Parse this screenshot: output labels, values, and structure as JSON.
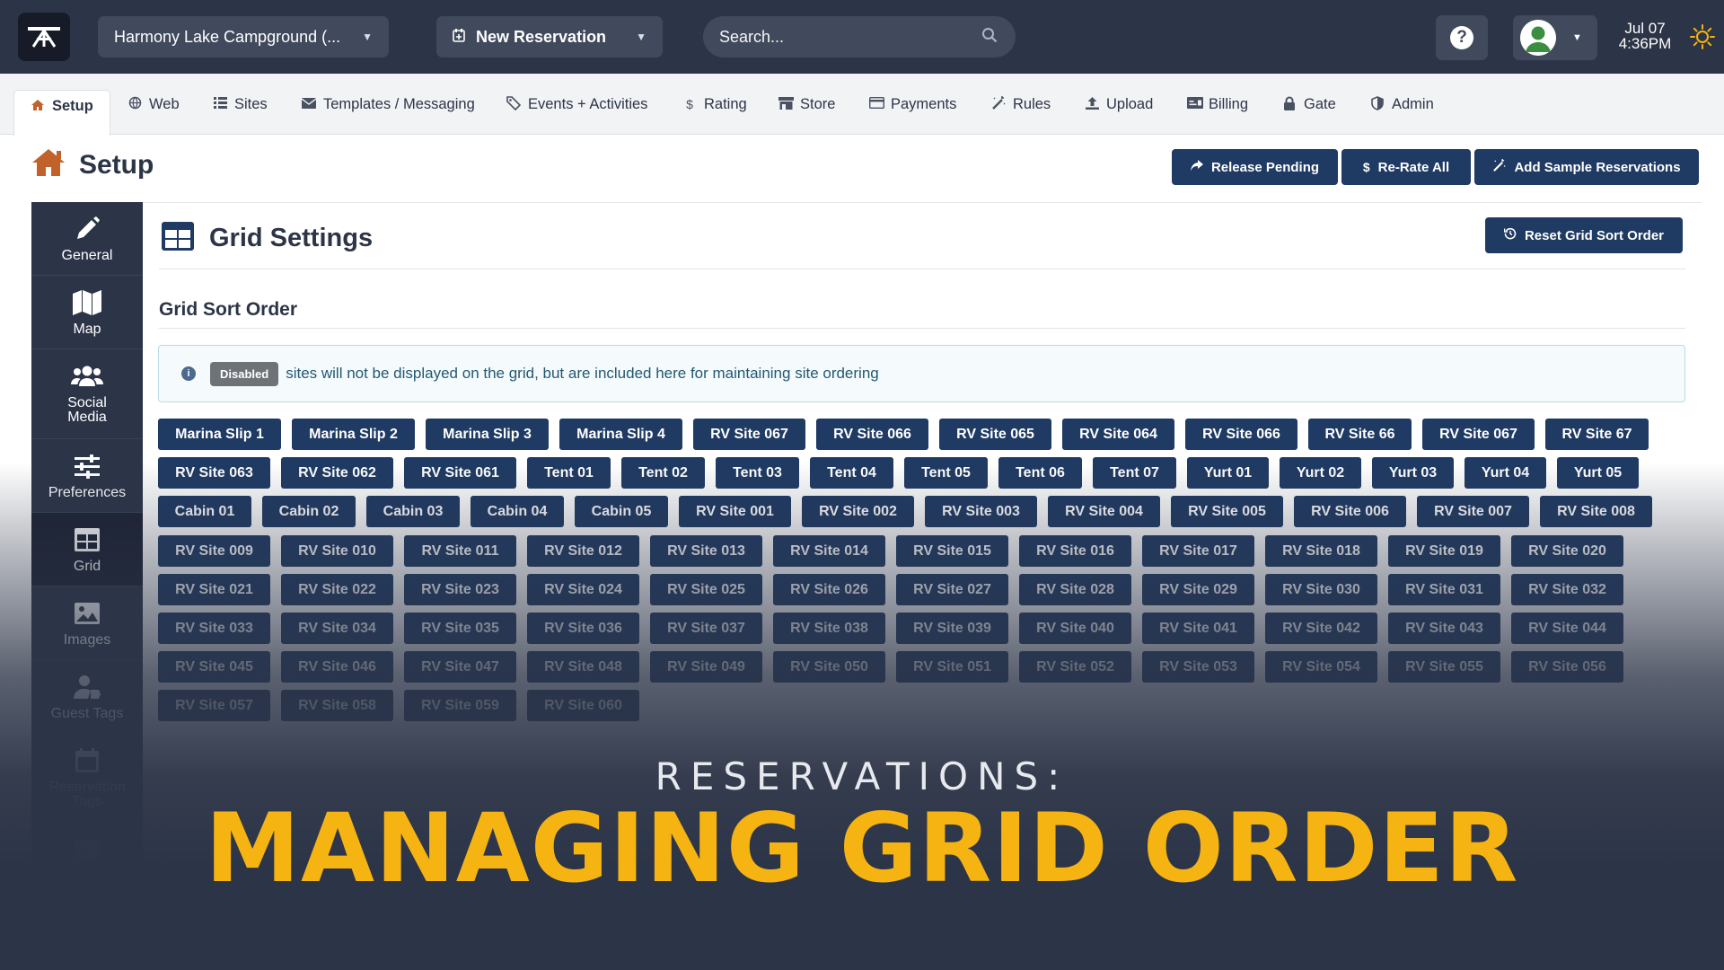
{
  "topbar": {
    "campground": "Harmony Lake Campground (...",
    "new_reservation": "New Reservation",
    "search_placeholder": "Search...",
    "help": "?",
    "date": "Jul 07",
    "time": "4:36PM"
  },
  "tabs": [
    {
      "label": "Setup",
      "icon": "home-icon"
    },
    {
      "label": "Web",
      "icon": "globe-icon"
    },
    {
      "label": "Sites",
      "icon": "list-icon"
    },
    {
      "label": "Templates / Messaging",
      "icon": "envelope-icon"
    },
    {
      "label": "Events + Activities",
      "icon": "ticket-icon"
    },
    {
      "label": "Rating",
      "icon": "dollar-icon"
    },
    {
      "label": "Store",
      "icon": "store-icon"
    },
    {
      "label": "Payments",
      "icon": "card-icon"
    },
    {
      "label": "Rules",
      "icon": "wand-icon"
    },
    {
      "label": "Upload",
      "icon": "upload-icon"
    },
    {
      "label": "Billing",
      "icon": "billing-icon"
    },
    {
      "label": "Gate",
      "icon": "lock-icon"
    },
    {
      "label": "Admin",
      "icon": "shield-icon"
    }
  ],
  "page": {
    "title": "Setup",
    "release_pending": "Release Pending",
    "rerate_all": "Re-Rate All",
    "add_sample": "Add Sample Reservations"
  },
  "sidenav": [
    {
      "label": "General",
      "icon": "pencil-icon"
    },
    {
      "label": "Map",
      "icon": "map-icon"
    },
    {
      "label": "Social Media",
      "icon": "users-icon"
    },
    {
      "label": "Preferences",
      "icon": "sliders-icon"
    },
    {
      "label": "Grid",
      "icon": "grid-icon"
    },
    {
      "label": "Images",
      "icon": "image-icon"
    },
    {
      "label": "Guest Tags",
      "icon": "user-tag-icon"
    },
    {
      "label": "Reservation Tags",
      "icon": "calendar-icon"
    },
    {
      "label": "Addresses",
      "icon": "envelope-icon"
    }
  ],
  "grid": {
    "title": "Grid Settings",
    "reset_label": "Reset Grid Sort Order",
    "sort_title": "Grid Sort Order",
    "info_badge": "Disabled",
    "info_text": "sites will not be displayed on the grid, but are included here for maintaining site ordering",
    "sites": [
      "Marina Slip 1",
      "Marina Slip 2",
      "Marina Slip 3",
      "Marina Slip 4",
      "RV Site 067",
      "RV Site 066",
      "RV Site 065",
      "RV Site 064",
      "RV Site 066",
      "RV Site 66",
      "RV Site 067",
      "RV Site 67",
      "RV Site 063",
      "RV Site 062",
      "RV Site 061",
      "Tent 01",
      "Tent 02",
      "Tent 03",
      "Tent 04",
      "Tent 05",
      "Tent 06",
      "Tent 07",
      "Yurt 01",
      "Yurt 02",
      "Yurt 03",
      "Yurt 04",
      "Yurt 05",
      "Cabin 01",
      "Cabin 02",
      "Cabin 03",
      "Cabin 04",
      "Cabin 05",
      "RV Site 001",
      "RV Site 002",
      "RV Site 003",
      "RV Site 004",
      "RV Site 005",
      "RV Site 006",
      "RV Site 007",
      "RV Site 008",
      "RV Site 009",
      "RV Site 010",
      "RV Site 011",
      "RV Site 012",
      "RV Site 013",
      "RV Site 014",
      "RV Site 015",
      "RV Site 016",
      "RV Site 017",
      "RV Site 018",
      "RV Site 019",
      "RV Site 020",
      "RV Site 021",
      "RV Site 022",
      "RV Site 023",
      "RV Site 024",
      "RV Site 025",
      "RV Site 026",
      "RV Site 027",
      "RV Site 028",
      "RV Site 029",
      "RV Site 030",
      "RV Site 031",
      "RV Site 032",
      "RV Site 033",
      "RV Site 034",
      "RV Site 035",
      "RV Site 036",
      "RV Site 037",
      "RV Site 038",
      "RV Site 039",
      "RV Site 040",
      "RV Site 041",
      "RV Site 042",
      "RV Site 043",
      "RV Site 044",
      "RV Site 045",
      "RV Site 046",
      "RV Site 047",
      "RV Site 048",
      "RV Site 049",
      "RV Site 050",
      "RV Site 051",
      "RV Site 052",
      "RV Site 053",
      "RV Site 054",
      "RV Site 055",
      "RV Site 056",
      "RV Site 057",
      "RV Site 058",
      "RV Site 059",
      "RV Site 060"
    ]
  },
  "overlay": {
    "subtitle": "RESERVATIONS:",
    "title": "MANAGING GRID ORDER"
  },
  "colors": {
    "topbar": "#2c3447",
    "button": "#1f3a63",
    "accent": "#c2622b",
    "overlay_title": "#f6b412"
  }
}
